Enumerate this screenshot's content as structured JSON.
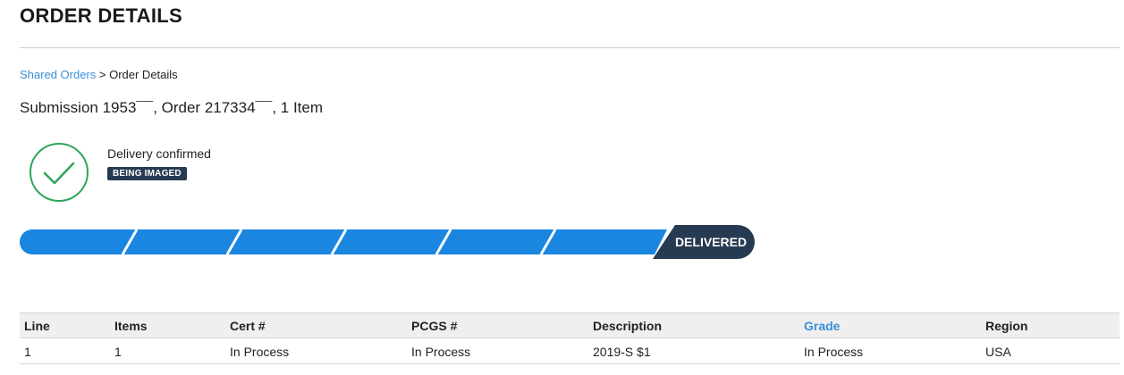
{
  "header": {
    "title": "ORDER DETAILS"
  },
  "breadcrumb": {
    "link": "Shared Orders",
    "separator": " > ",
    "current": "Order Details"
  },
  "submission": {
    "text": "Submission 1953¯¯, Order 217334¯¯, 1 Item"
  },
  "status": {
    "message": "Delivery confirmed",
    "badge": "BEING IMAGED",
    "icon": "check-circle-icon",
    "icon_color": "#2fa55a"
  },
  "progress": {
    "completed_steps": 6,
    "total_steps": 7,
    "current_label": "DELIVERED",
    "segment_color": "#1a86e0",
    "current_color": "#263a52"
  },
  "table": {
    "headers": [
      "Line",
      "Items",
      "Cert #",
      "PCGS #",
      "Description",
      "Grade",
      "Region"
    ],
    "rows": [
      [
        "1",
        "1",
        "In Process",
        "In Process",
        "2019-S $1",
        "In Process",
        "USA"
      ]
    ]
  }
}
